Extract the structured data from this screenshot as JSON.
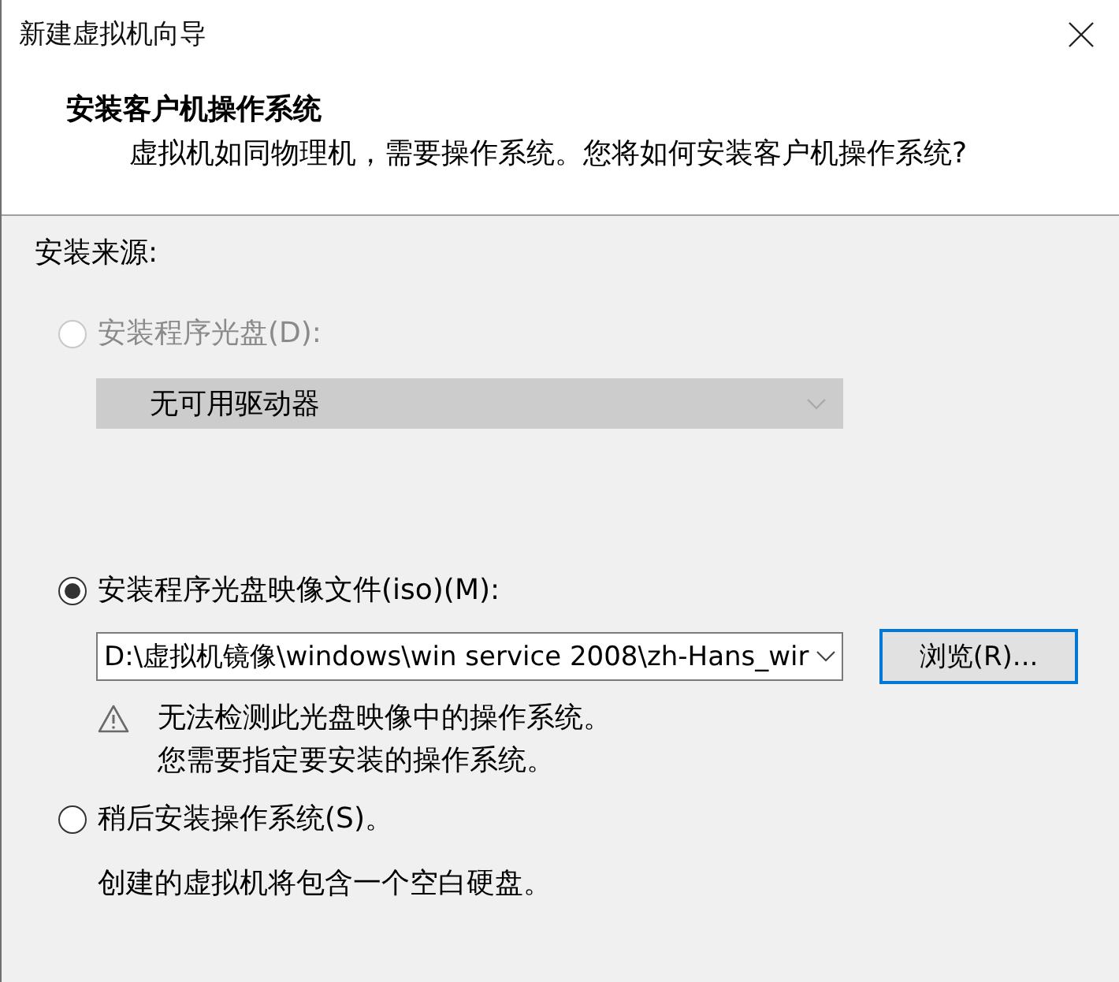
{
  "window": {
    "title": "新建虚拟机向导"
  },
  "header": {
    "title": "安装客户机操作系统",
    "subtitle": "虚拟机如同物理机，需要操作系统。您将如何安装客户机操作系统?"
  },
  "source": {
    "label": "安装来源:",
    "options": [
      {
        "kind": "drive",
        "label": "安装程序光盘(D):",
        "selected": false,
        "disabled": true,
        "dropdown": {
          "value": "无可用驱动器",
          "disabled": true
        }
      },
      {
        "kind": "image",
        "label": "安装程序光盘映像文件(iso)(M):",
        "selected": true,
        "disabled": false,
        "path": {
          "value": "D:\\虚拟机镜像\\windows\\win service 2008\\zh-Hans_wir"
        },
        "browse_button": {
          "label": "浏览(R)...",
          "focused": true
        },
        "warning": {
          "lines": [
            "无法检测此光盘映像中的操作系统。",
            "您需要指定要安装的操作系统。"
          ]
        }
      },
      {
        "kind": "later",
        "label": "稍后安装操作系统(S)。",
        "selected": false,
        "disabled": false,
        "note": "创建的虚拟机将包含一个空白硬盘。"
      }
    ]
  }
}
